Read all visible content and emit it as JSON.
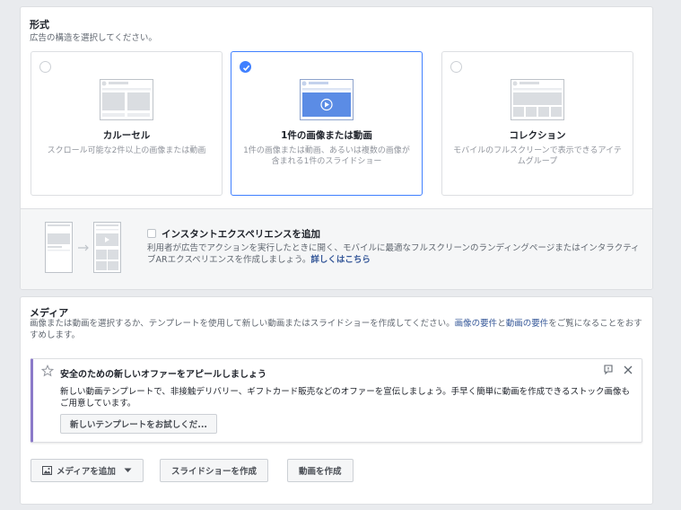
{
  "format": {
    "title": "形式",
    "subtitle": "広告の構造を選択してください。",
    "options": [
      {
        "title": "カルーセル",
        "desc": "スクロール可能な2件以上の画像または動画",
        "selected": false
      },
      {
        "title": "1件の画像または動画",
        "desc": "1件の画像または動画、あるいは複数の画像が含まれる1件のスライドショー",
        "selected": true
      },
      {
        "title": "コレクション",
        "desc": "モバイルのフルスクリーンで表示できるアイテムグループ",
        "selected": false
      }
    ],
    "instant_experience": {
      "label": "インスタントエクスペリエンスを追加",
      "checked": false,
      "desc": "利用者が広告でアクションを実行したときに開く、モバイルに最適なフルスクリーンのランディングページまたはインタラクティブARエクスペリエンスを作成しましょう。",
      "link": "詳しくはこちら"
    }
  },
  "media": {
    "title": "メディア",
    "desc_part1": "画像または動画を選択するか、テンプレートを使用して新しい動画またはスライドショーを作成してください。",
    "image_req_link": "画像の要件",
    "desc_and": "と",
    "video_req_link": "動画の要件",
    "desc_part2": "をご覧になることをおすすめします。",
    "promo": {
      "title": "安全のための新しいオファーをアピールしましょう",
      "text": "新しい動画テンプレートで、非接触デリバリー、ギフトカード販売などのオファーを宣伝しましょう。手早く簡単に動画を作成できるストック画像もご用意しています。",
      "button": "新しいテンプレートをお試しくだ..."
    },
    "buttons": {
      "add_media": "メディアを追加",
      "create_slideshow": "スライドショーを作成",
      "create_video": "動画を作成"
    }
  },
  "colors": {
    "accent": "#4080ff",
    "link": "#365899",
    "promo_bar": "#8b7ac9"
  }
}
